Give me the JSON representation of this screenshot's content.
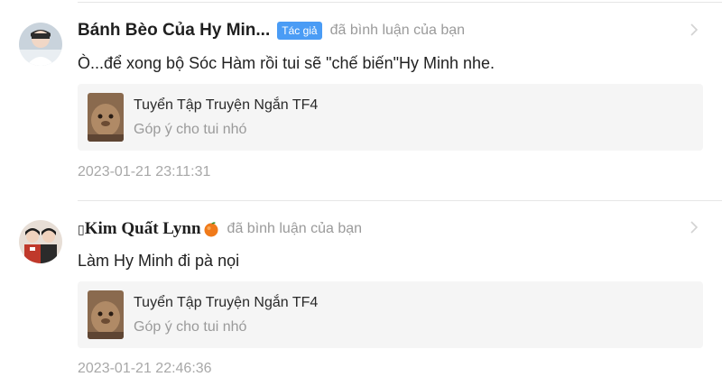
{
  "notifications": [
    {
      "user_name": "Bánh Bèo Của Hy Min...",
      "badge": "Tác giả",
      "action": "đã bình luận của bạn",
      "comment": "Ò...để xong bộ Sóc Hàm rồi tui sẽ \"chế biến\"Hy Minh nhe.",
      "story_title": "Tuyển Tập Truyện Ngắn TF4",
      "story_comment": "Góp ý cho tui nhó",
      "timestamp": "2023-01-21 23:11:31",
      "avatar_icon": "user-avatar"
    },
    {
      "user_name": "Kim Quất Lynn",
      "user_name_prefix": "▯",
      "user_name_emoji": "orange-emoji",
      "action": "đã bình luận của bạn",
      "comment": "Làm Hy Minh đi pà nọi",
      "story_title": "Tuyển Tập Truyện Ngắn TF4",
      "story_comment": "Góp ý cho tui nhó",
      "timestamp": "2023-01-21 22:46:36",
      "avatar_icon": "user-avatar"
    }
  ],
  "colors": {
    "badge_bg": "#4a9cf5",
    "muted_text": "#9a9a9a",
    "card_bg": "#f5f5f5",
    "divider": "#e6e6e6"
  }
}
